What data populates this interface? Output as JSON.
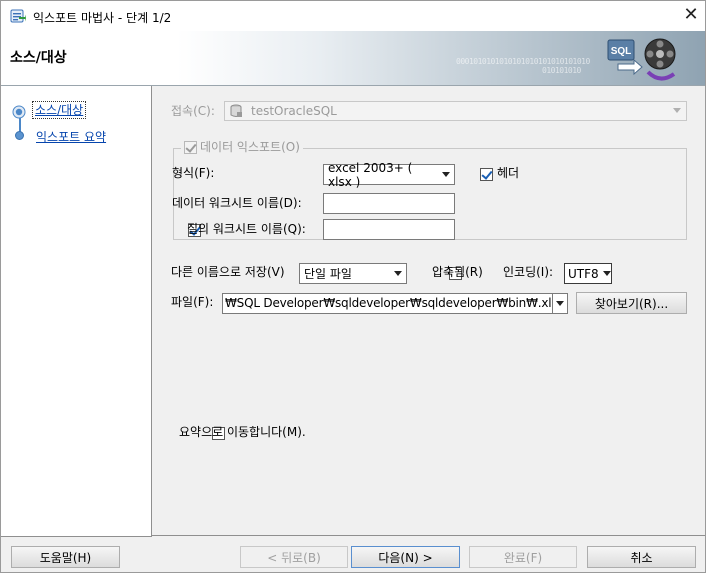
{
  "window": {
    "title": "익스포트 마법사 - 단계 1/2",
    "close_glyph": "✕"
  },
  "banner": {
    "heading": "소스/대상",
    "decor_binary": "0001010101010101010101010101010",
    "decor_binary_2": "010101010",
    "logo_text": "SQL"
  },
  "sidebar": {
    "steps": [
      {
        "label": "소스/대상",
        "active": true
      },
      {
        "label": "익스포트 요약",
        "active": false
      }
    ]
  },
  "form": {
    "connection": {
      "label": "접속(C):",
      "value": "testOracleSQL",
      "enabled": false
    },
    "export_data": {
      "label": "데이터 익스포트(O)",
      "checked": true,
      "enabled": false
    },
    "format": {
      "label": "형식(F):",
      "value": "excel 2003+ ( xlsx )"
    },
    "header": {
      "label": "헤더",
      "checked": true
    },
    "data_sheet": {
      "label": "데이터 워크시트 이름(D):",
      "value": ""
    },
    "query_sheet": {
      "label": "질의 워크시트 이름(Q):",
      "checked": true,
      "value": ""
    },
    "save_as": {
      "label": "다른 이름으로 저장(V)",
      "value": "단일 파일"
    },
    "compressed": {
      "label": "압축됨(R)",
      "checked": false
    },
    "encoding": {
      "label": "인코딩(I):",
      "value": "UTF8"
    },
    "file": {
      "label": "파일(F):",
      "value": "₩SQL Developer₩sqldeveloper₩sqldeveloper₩bin₩.xlsx"
    },
    "browse_label": "찾아보기(R)...",
    "jump_to_summary": {
      "label": "요약으로 이동합니다(M).",
      "checked": false
    }
  },
  "buttons": {
    "help": "도움말(H)",
    "back": "< 뒤로(B)",
    "next": "다음(N) >",
    "finish": "완료(F)",
    "cancel": "취소"
  },
  "colors": {
    "link": "#0645ad",
    "disabled_text": "#9a9a9a",
    "checkbox_check": "#1a5fb4",
    "step_blue": "#4b87c8"
  }
}
